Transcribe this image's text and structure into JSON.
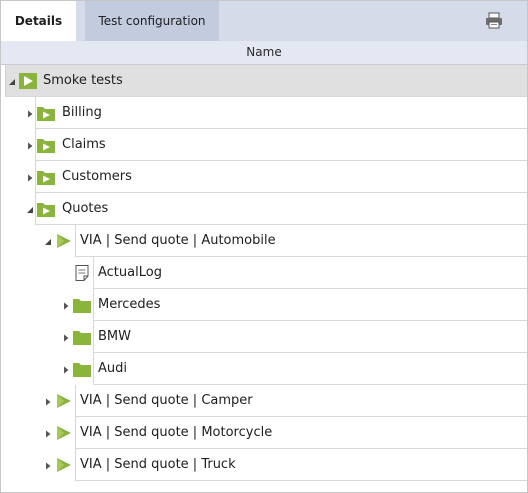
{
  "tabs": [
    {
      "label": "Details"
    },
    {
      "label": "Test configuration"
    }
  ],
  "toolbar": {
    "print_icon": "printer-icon"
  },
  "grid": {
    "column_name": "Name"
  },
  "tree": {
    "rows": [
      {
        "label": "Smoke tests",
        "icon": "suite-icon",
        "state": "expanded"
      },
      {
        "label": "Billing",
        "icon": "suite-folder-icon",
        "state": "collapsed"
      },
      {
        "label": "Claims",
        "icon": "suite-folder-icon",
        "state": "collapsed"
      },
      {
        "label": "Customers",
        "icon": "suite-folder-icon",
        "state": "collapsed"
      },
      {
        "label": "Quotes",
        "icon": "suite-folder-icon",
        "state": "expanded"
      },
      {
        "label": "VIA | Send quote | Automobile",
        "icon": "test-case-icon",
        "state": "expanded"
      },
      {
        "label": "ActualLog",
        "icon": "log-document-icon",
        "state": "leaf"
      },
      {
        "label": "Mercedes",
        "icon": "folder-icon",
        "state": "collapsed"
      },
      {
        "label": "BMW",
        "icon": "folder-icon",
        "state": "collapsed"
      },
      {
        "label": "Audi",
        "icon": "folder-icon",
        "state": "collapsed"
      },
      {
        "label": "VIA | Send quote | Camper",
        "icon": "test-case-icon",
        "state": "collapsed"
      },
      {
        "label": "VIA | Send quote | Motorcycle",
        "icon": "test-case-icon",
        "state": "collapsed"
      },
      {
        "label": "VIA | Send quote | Truck",
        "icon": "test-case-icon",
        "state": "collapsed"
      }
    ]
  },
  "colors": {
    "tab_bar": "#d6dbe9",
    "icon_green": "#8ab43c",
    "root_row": "#e0e0e0"
  }
}
